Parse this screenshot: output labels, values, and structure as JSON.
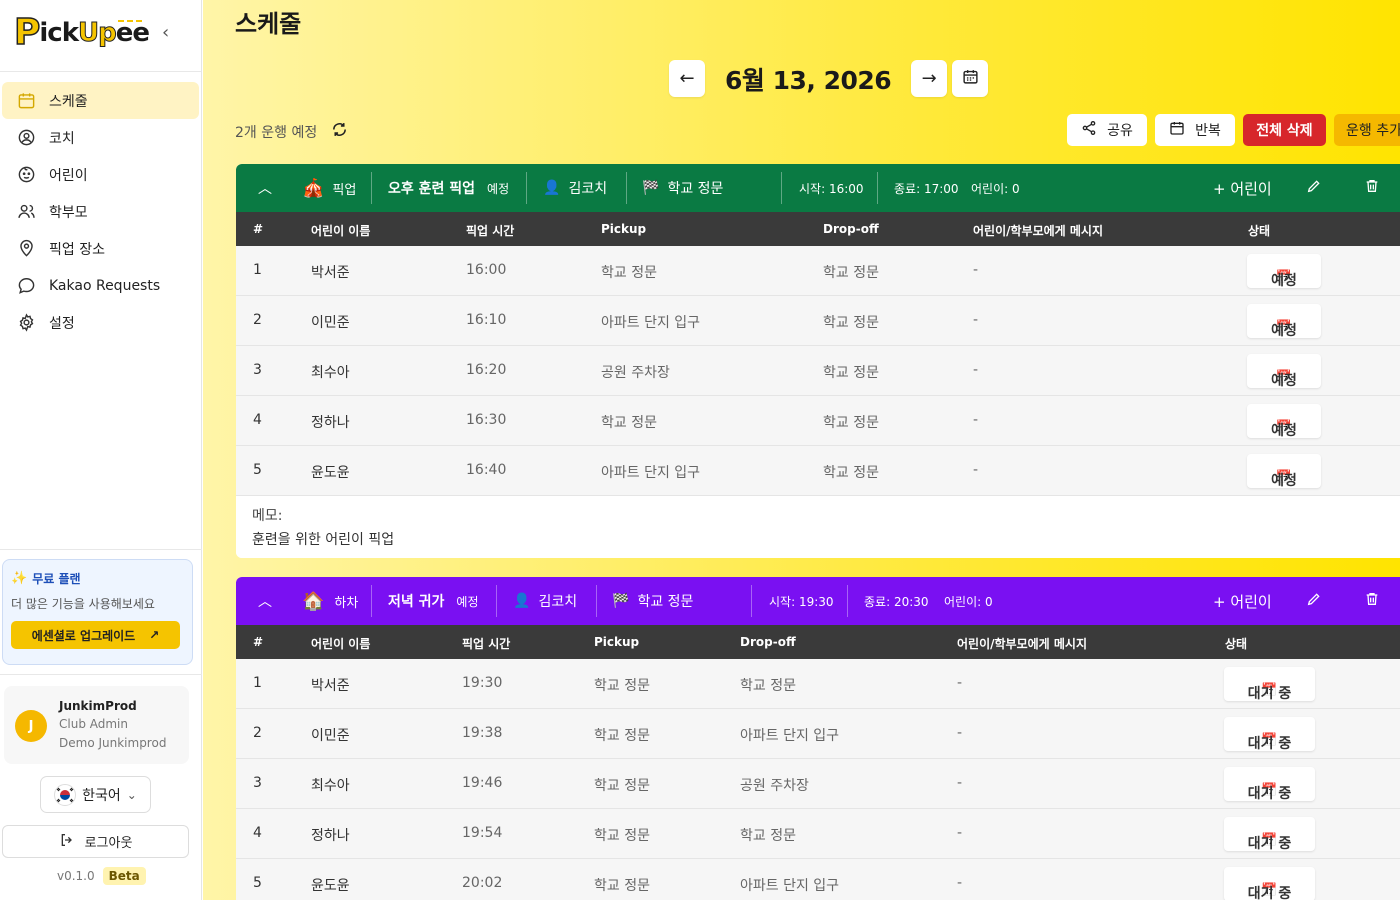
{
  "app": {
    "logo": "PickUpee",
    "logo_p": "P",
    "logo_ick": "ick",
    "logo_up": "Up",
    "logo_ee": "ee"
  },
  "sidebar": {
    "items": [
      {
        "label": "스케줄",
        "icon": "calendar-icon"
      },
      {
        "label": "코치",
        "icon": "user-circle-icon"
      },
      {
        "label": "어린이",
        "icon": "child-face-icon"
      },
      {
        "label": "학부모",
        "icon": "users-icon"
      },
      {
        "label": "픽업 장소",
        "icon": "map-pin-icon"
      },
      {
        "label": "Kakao Requests",
        "icon": "chat-bubble-icon"
      },
      {
        "label": "설정",
        "icon": "gear-icon"
      }
    ],
    "plan": {
      "title": "무료 플랜",
      "subtitle": "더 많은 기능을 사용해보세요",
      "upgrade": "에센셜로 업그레이드"
    },
    "user": {
      "initial": "J",
      "name": "JunkimProd",
      "role": "Club Admin",
      "org": "Demo Junkimprod"
    },
    "language": "한국어",
    "logout": "로그아웃",
    "version": "v0.1.0",
    "beta": "Beta"
  },
  "main": {
    "title": "스케줄",
    "prev": "←",
    "next": "→",
    "date": "6월 13, 2026",
    "count": "2개 운행 예정",
    "actions": {
      "share": "공유",
      "repeat": "반복",
      "delete_all": "전체 삭제",
      "add_run": "운행 추가"
    }
  },
  "runs": [
    {
      "type_icon": "🎪",
      "type": "픽업",
      "name": "오후 훈련 픽업",
      "status": "예정",
      "coach": "김코치",
      "location": "학교 정문",
      "start": "시작: 16:00",
      "end": "종료: 17:00",
      "kids": "어린이: 0",
      "add_child": "+ 어린이",
      "headers": [
        "#",
        "어린이 이름",
        "픽업 시간",
        "Pickup",
        "Drop-off",
        "어린이/학부모에게 메시지",
        "상태"
      ],
      "rows": [
        {
          "n": "1",
          "name": "박서준",
          "time": "16:00",
          "pickup": "학교 정문",
          "dropoff": "학교 정문",
          "msg": "-",
          "status": "예정"
        },
        {
          "n": "2",
          "name": "이민준",
          "time": "16:10",
          "pickup": "아파트 단지 입구",
          "dropoff": "학교 정문",
          "msg": "-",
          "status": "예정"
        },
        {
          "n": "3",
          "name": "최수아",
          "time": "16:20",
          "pickup": "공원 주차장",
          "dropoff": "학교 정문",
          "msg": "-",
          "status": "예정"
        },
        {
          "n": "4",
          "name": "정하나",
          "time": "16:30",
          "pickup": "학교 정문",
          "dropoff": "학교 정문",
          "msg": "-",
          "status": "예정"
        },
        {
          "n": "5",
          "name": "윤도윤",
          "time": "16:40",
          "pickup": "아파트 단지 입구",
          "dropoff": "학교 정문",
          "msg": "-",
          "status": "예정"
        }
      ],
      "memo_label": "메모:",
      "memo": "훈련을 위한 어린이 픽업"
    },
    {
      "type_icon": "🏠",
      "type": "하차",
      "name": "저녁 귀가",
      "status": "예정",
      "coach": "김코치",
      "location": "학교 정문",
      "start": "시작: 19:30",
      "end": "종료: 20:30",
      "kids": "어린이: 0",
      "add_child": "+ 어린이",
      "headers": [
        "#",
        "어린이 이름",
        "픽업 시간",
        "Pickup",
        "Drop-off",
        "어린이/학부모에게 메시지",
        "상태"
      ],
      "rows": [
        {
          "n": "1",
          "name": "박서준",
          "time": "19:30",
          "pickup": "학교 정문",
          "dropoff": "학교 정문",
          "msg": "-",
          "status": "대기 중"
        },
        {
          "n": "2",
          "name": "이민준",
          "time": "19:38",
          "pickup": "학교 정문",
          "dropoff": "아파트 단지 입구",
          "msg": "-",
          "status": "대기 중"
        },
        {
          "n": "3",
          "name": "최수아",
          "time": "19:46",
          "pickup": "학교 정문",
          "dropoff": "공원 주차장",
          "msg": "-",
          "status": "대기 중"
        },
        {
          "n": "4",
          "name": "정하나",
          "time": "19:54",
          "pickup": "학교 정문",
          "dropoff": "학교 정문",
          "msg": "-",
          "status": "대기 중"
        },
        {
          "n": "5",
          "name": "윤도윤",
          "time": "20:02",
          "pickup": "학교 정문",
          "dropoff": "아파트 단지 입구",
          "msg": "-",
          "status": "대기 중"
        }
      ]
    }
  ],
  "colors": {
    "brand": "#f5c400",
    "run1": "#0a7a43",
    "run2": "#7a10f2",
    "danger": "#d7262b"
  }
}
